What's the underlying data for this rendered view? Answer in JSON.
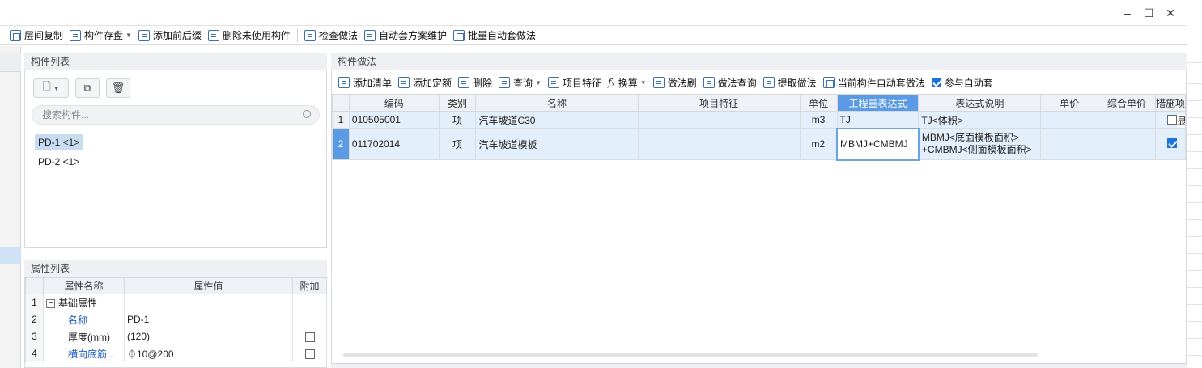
{
  "window": {
    "controls": {
      "minimize": "–",
      "maximize": "☐",
      "close": "✕"
    }
  },
  "toolbar": {
    "items": [
      {
        "label": "层间复制",
        "icon": "copy-icon"
      },
      {
        "label": "构件存盘",
        "icon": "save-icon",
        "dropdown": true
      },
      {
        "label": "添加前后缀",
        "icon": "prefix-icon"
      },
      {
        "label": "删除未使用构件",
        "icon": "delete-unused-icon"
      },
      {
        "label": "检查做法",
        "icon": "check-icon"
      },
      {
        "label": "自动套方案维护",
        "icon": "scheme-icon"
      },
      {
        "label": "批量自动套做法",
        "icon": "batch-icon"
      }
    ]
  },
  "component_panel": {
    "title": "构件列表",
    "search_placeholder": "搜索构件...",
    "items": [
      {
        "label": "PD-1 <1>",
        "selected": true
      },
      {
        "label": "PD-2 <1>",
        "selected": false
      }
    ]
  },
  "property_panel": {
    "title": "属性列表",
    "headers": [
      "属性名称",
      "属性值",
      "附加"
    ],
    "rows": [
      {
        "num": "1",
        "name": "基础属性",
        "value": "",
        "group": true
      },
      {
        "num": "2",
        "name": "名称",
        "value": "PD-1",
        "blue": true
      },
      {
        "num": "3",
        "name": "厚度(mm)",
        "value": "(120)",
        "check": false
      },
      {
        "num": "4",
        "name": "横向底筋...",
        "value": "⏀10@200",
        "blue": true,
        "check": false
      }
    ]
  },
  "method_panel": {
    "title": "构件做法",
    "toolbar": [
      {
        "label": "添加清单",
        "icon": "add-list-icon"
      },
      {
        "label": "添加定额",
        "icon": "add-quota-icon"
      },
      {
        "label": "删除",
        "icon": "delete-icon"
      },
      {
        "label": "查询",
        "icon": "query-icon",
        "dropdown": true
      },
      {
        "label": "项目特征",
        "icon": "feature-icon"
      },
      {
        "label": "换算",
        "icon": "fx-icon",
        "dropdown": true
      },
      {
        "label": "做法刷",
        "icon": "brush-icon"
      },
      {
        "label": "做法查询",
        "icon": "method-query-icon"
      },
      {
        "label": "提取做法",
        "icon": "extract-icon"
      },
      {
        "label": "当前构件自动套做法",
        "icon": "auto-apply-icon"
      },
      {
        "label": "参与自动套",
        "icon": "checkbox-icon",
        "checked": true
      }
    ],
    "headers": [
      "编码",
      "类别",
      "名称",
      "项目特征",
      "单位",
      "工程量表达式",
      "表达式说明",
      "单价",
      "综合单价",
      "措施项"
    ],
    "rows": [
      {
        "num": "1",
        "code": "010505001",
        "type": "项",
        "name": "汽车坡道C30",
        "feature": "",
        "unit": "m3",
        "expr": "TJ",
        "desc1": "TJ<体积>",
        "desc2": "",
        "price": "",
        "total": "",
        "measure": false
      },
      {
        "num": "2",
        "code": "011702014",
        "type": "项",
        "name": "汽车坡道模板",
        "feature": "",
        "unit": "m2",
        "expr": "MBMJ+CMBMJ",
        "desc1": "MBMJ<底面模板面积>",
        "desc2": "+CMBMJ<侧面模板面积>",
        "price": "",
        "total": "",
        "measure": true
      }
    ],
    "edge_fragment": "显示"
  }
}
